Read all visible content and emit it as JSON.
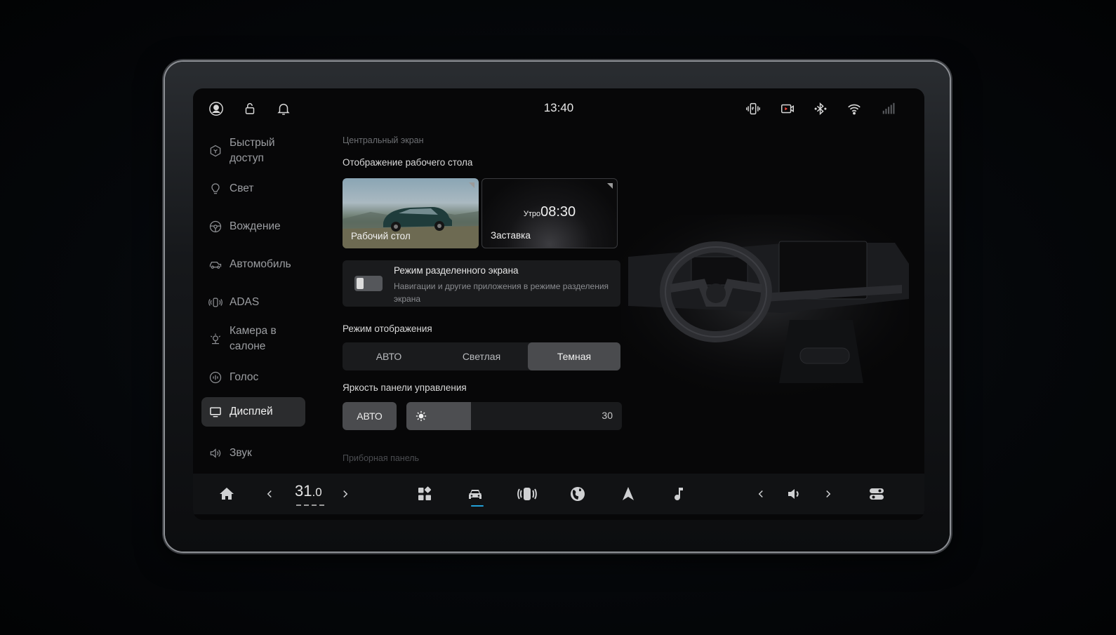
{
  "status_bar": {
    "time": "13:40",
    "left_icons": [
      "profile-icon",
      "lock-icon",
      "bell-icon"
    ],
    "right_icons": [
      "phone-projection-icon",
      "dashcam-icon",
      "bluetooth-icon",
      "wifi-icon",
      "signal-icon"
    ]
  },
  "sidebar": {
    "items": [
      {
        "label": "Быстрый доступ",
        "icon": "quick-access-icon"
      },
      {
        "label": "Свет",
        "icon": "bulb-icon"
      },
      {
        "label": "Вождение",
        "icon": "steering-wheel-icon"
      },
      {
        "label": "Автомобиль",
        "icon": "car-icon"
      },
      {
        "label": "ADAS",
        "icon": "adas-icon"
      },
      {
        "label": "Камера в салоне",
        "icon": "cabin-camera-icon"
      },
      {
        "label": "Голос",
        "icon": "voice-icon"
      },
      {
        "label": "Дисплей",
        "icon": "display-icon",
        "active": true
      },
      {
        "label": "Звук",
        "icon": "speaker-icon"
      }
    ]
  },
  "content": {
    "section_center": "Центральный экран",
    "desktop_title": "Отображение рабочего стола",
    "cards": {
      "desktop_label": "Рабочий стол",
      "screensaver_label": "Заставка",
      "clock_prefix": "Утро",
      "clock_time": "08:30"
    },
    "split_screen": {
      "title": "Режим разделенного экрана",
      "description": "Навигации и другие приложения в режиме разделения экрана",
      "enabled": false
    },
    "display_mode": {
      "title": "Режим отображения",
      "options": [
        "АВТО",
        "Светлая",
        "Темная"
      ],
      "selected": "Темная"
    },
    "brightness": {
      "title": "Яркость панели управления",
      "auto_label": "АВТО",
      "value": "30",
      "fraction": 0.3
    },
    "section_instrument": "Приборная панель"
  },
  "dock": {
    "temperature_int": "31",
    "temperature_dec": ".0",
    "icons": [
      "home-icon",
      "apps-icon",
      "car-icon",
      "phone-projection-icon",
      "globe-icon",
      "navigation-icon",
      "music-icon",
      "volume-icon",
      "controls-icon"
    ],
    "active": "car-icon"
  }
}
